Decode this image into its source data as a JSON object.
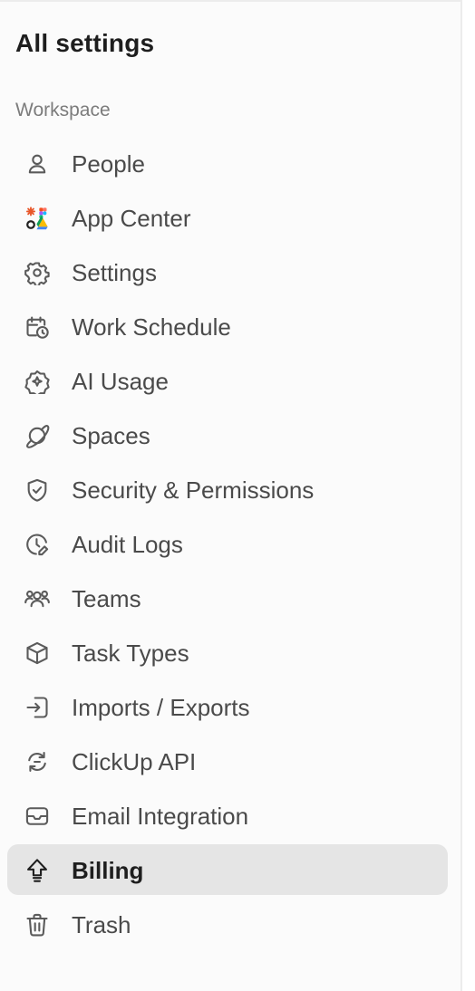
{
  "sidebar": {
    "title": "All settings",
    "section": "Workspace",
    "items": [
      {
        "label": "People",
        "icon": "person-icon"
      },
      {
        "label": "App Center",
        "icon": "app-center-icon"
      },
      {
        "label": "Settings",
        "icon": "gear-icon"
      },
      {
        "label": "Work Schedule",
        "icon": "calendar-clock-icon"
      },
      {
        "label": "AI Usage",
        "icon": "ai-sparkle-icon"
      },
      {
        "label": "Spaces",
        "icon": "planet-icon"
      },
      {
        "label": "Security & Permissions",
        "icon": "shield-check-icon"
      },
      {
        "label": "Audit Logs",
        "icon": "clock-edit-icon"
      },
      {
        "label": "Teams",
        "icon": "team-icon"
      },
      {
        "label": "Task Types",
        "icon": "cube-icon"
      },
      {
        "label": "Imports / Exports",
        "icon": "import-icon"
      },
      {
        "label": "ClickUp API",
        "icon": "api-sync-icon"
      },
      {
        "label": "Email Integration",
        "icon": "mail-icon"
      },
      {
        "label": "Billing",
        "icon": "upgrade-arrow-icon",
        "active": true
      },
      {
        "label": "Trash",
        "icon": "trash-icon"
      }
    ]
  },
  "colors": {
    "active_bg": "#e5e5e5",
    "text": "#4a4a4a",
    "section_label": "#7c7c7c"
  }
}
